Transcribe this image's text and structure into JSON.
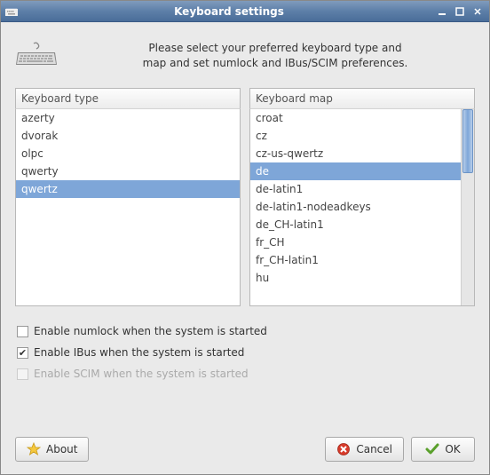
{
  "window": {
    "title": "Keyboard settings"
  },
  "intro": {
    "line1": "Please select your preferred keyboard type and",
    "line2": "map and set numlock and IBus/SCIM preferences."
  },
  "lists": {
    "type_header": "Keyboard type",
    "map_header": "Keyboard map",
    "type_items": [
      "azerty",
      "dvorak",
      "olpc",
      "qwerty",
      "qwertz"
    ],
    "type_selected": "qwertz",
    "map_items": [
      "croat",
      "cz",
      "cz-us-qwertz",
      "de",
      "de-latin1",
      "de-latin1-nodeadkeys",
      "de_CH-latin1",
      "fr_CH",
      "fr_CH-latin1",
      "hu"
    ],
    "map_selected": "de"
  },
  "checks": {
    "numlock": {
      "label": "Enable numlock when the system is started",
      "checked": false,
      "enabled": true
    },
    "ibus": {
      "label": "Enable IBus when the system is started",
      "checked": true,
      "enabled": true
    },
    "scim": {
      "label": "Enable SCIM when the system is started",
      "checked": false,
      "enabled": false
    }
  },
  "buttons": {
    "about": "About",
    "cancel": "Cancel",
    "ok": "OK"
  }
}
